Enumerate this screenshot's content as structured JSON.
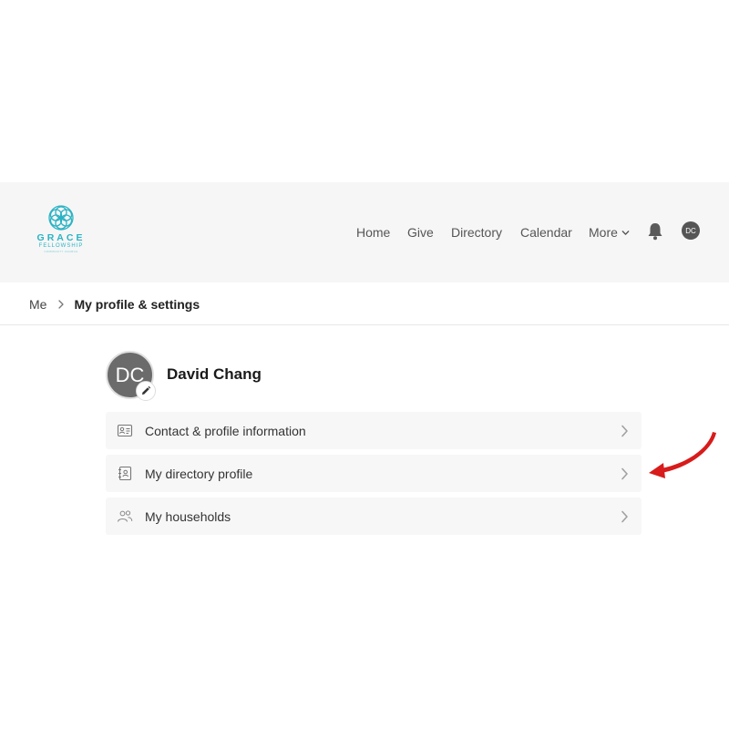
{
  "brand": {
    "name": "GRACE",
    "subname": "FELLOWSHIP",
    "tagline": "COMMUNITY CHURCH",
    "color": "#2bb3c4"
  },
  "nav": {
    "items": [
      {
        "label": "Home"
      },
      {
        "label": "Give"
      },
      {
        "label": "Directory"
      },
      {
        "label": "Calendar"
      },
      {
        "label": "More"
      }
    ],
    "notifications_icon": "bell-icon",
    "user_initials": "DC"
  },
  "breadcrumb": {
    "root": "Me",
    "current": "My profile & settings"
  },
  "profile": {
    "initials": "DC",
    "name": "David Chang",
    "edit_icon": "pencil-icon"
  },
  "menu": [
    {
      "label": "Contact & profile information",
      "icon": "id-card-icon"
    },
    {
      "label": "My directory profile",
      "icon": "contact-book-icon"
    },
    {
      "label": "My households",
      "icon": "people-icon"
    }
  ],
  "annotation": {
    "arrow_color": "#d81b1b",
    "points_to": "My directory profile"
  }
}
